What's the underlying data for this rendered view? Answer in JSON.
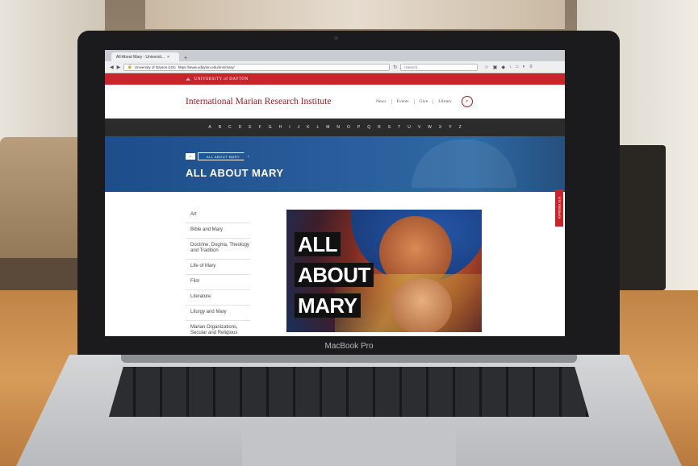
{
  "browser": {
    "tab_title": "All About Mary : Universit...",
    "tab_close": "×",
    "tab_new": "+",
    "url_site": "University of Dayton (US)",
    "url": "https://www.udayton.edu/imri/mary/",
    "search_placeholder": "Search"
  },
  "site": {
    "university": "UNIVERSITY of DAYTON",
    "title": "International Marian Research Institute",
    "nav": [
      "News",
      "Events",
      "Give",
      "Library"
    ]
  },
  "alphabet": [
    "A",
    "B",
    "C",
    "D",
    "E",
    "F",
    "G",
    "H",
    "I",
    "J",
    "K",
    "L",
    "M",
    "N",
    "O",
    "P",
    "Q",
    "R",
    "S",
    "T",
    "U",
    "V",
    "W",
    "X",
    "Y",
    "Z"
  ],
  "breadcrumb": "ALL ABOUT MARY",
  "page_title": "ALL ABOUT MARY",
  "feedback_tab": "SITE FEEDBACK",
  "sidebar": [
    "Art",
    "Bible and Mary",
    "Doctrine, Dogma, Theology and Tradition",
    "Life of Mary",
    "Film",
    "Literature",
    "Liturgy and Mary",
    "Marian Organizations, Secular and Religious"
  ],
  "feature_words": [
    "ALL",
    "ABOUT",
    "MARY"
  ],
  "laptop_brand": "MacBook Pro"
}
